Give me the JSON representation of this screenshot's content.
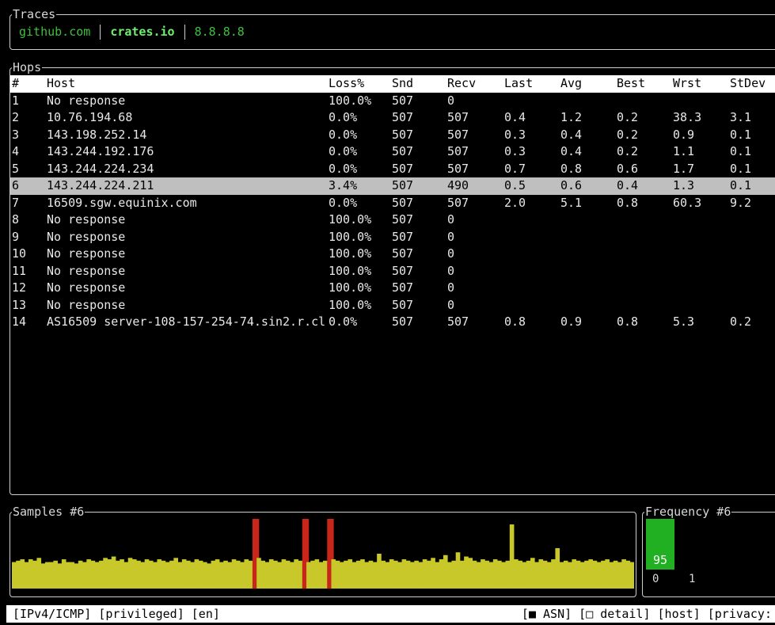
{
  "traces": {
    "title": "Traces",
    "tabs": [
      {
        "label": "github.com",
        "active": false
      },
      {
        "label": "crates.io",
        "active": true
      },
      {
        "label": "8.8.8.8",
        "active": false
      }
    ]
  },
  "hops": {
    "title": "Hops",
    "columns": [
      "#",
      "Host",
      "Loss%",
      "Snd",
      "Recv",
      "Last",
      "Avg",
      "Best",
      "Wrst",
      "StDev"
    ],
    "selected_index": 5,
    "rows": [
      [
        "1",
        "No response",
        "100.0%",
        "507",
        "0",
        "",
        "",
        "",
        "",
        ""
      ],
      [
        "2",
        "10.76.194.68",
        "0.0%",
        "507",
        "507",
        "0.4",
        "1.2",
        "0.2",
        "38.3",
        "3.1"
      ],
      [
        "3",
        "143.198.252.14",
        "0.0%",
        "507",
        "507",
        "0.3",
        "0.4",
        "0.2",
        "0.9",
        "0.1"
      ],
      [
        "4",
        "143.244.192.176",
        "0.0%",
        "507",
        "507",
        "0.3",
        "0.4",
        "0.2",
        "1.1",
        "0.1"
      ],
      [
        "5",
        "143.244.224.234",
        "0.0%",
        "507",
        "507",
        "0.7",
        "0.8",
        "0.6",
        "1.7",
        "0.1"
      ],
      [
        "6",
        "143.244.224.211",
        "3.4%",
        "507",
        "490",
        "0.5",
        "0.6",
        "0.4",
        "1.3",
        "0.1"
      ],
      [
        "7",
        "16509.sgw.equinix.com",
        "0.0%",
        "507",
        "507",
        "2.0",
        "5.1",
        "0.8",
        "60.3",
        "9.2"
      ],
      [
        "8",
        "No response",
        "100.0%",
        "507",
        "0",
        "",
        "",
        "",
        "",
        ""
      ],
      [
        "9",
        "No response",
        "100.0%",
        "507",
        "0",
        "",
        "",
        "",
        "",
        ""
      ],
      [
        "10",
        "No response",
        "100.0%",
        "507",
        "0",
        "",
        "",
        "",
        "",
        ""
      ],
      [
        "11",
        "No response",
        "100.0%",
        "507",
        "0",
        "",
        "",
        "",
        "",
        ""
      ],
      [
        "12",
        "No response",
        "100.0%",
        "507",
        "0",
        "",
        "",
        "",
        "",
        ""
      ],
      [
        "13",
        "No response",
        "100.0%",
        "507",
        "0",
        "",
        "",
        "",
        "",
        ""
      ],
      [
        "14",
        "AS16509 server-108-157-254-74.sin2.r.cl",
        "0.0%",
        "507",
        "507",
        "0.8",
        "0.9",
        "0.8",
        "5.3",
        "0.2"
      ]
    ]
  },
  "samples": {
    "title": "Samples #6",
    "bar_color": "#c8c82a",
    "loss_color": "#c8261a",
    "values": [
      0.38,
      0.4,
      0.42,
      0.38,
      0.42,
      0.4,
      0.44,
      0.36,
      0.38,
      0.38,
      0.4,
      0.36,
      0.42,
      0.38,
      0.38,
      0.36,
      0.4,
      0.38,
      0.42,
      0.4,
      0.38,
      0.4,
      0.44,
      0.42,
      0.46,
      0.4,
      0.42,
      0.38,
      0.44,
      0.42,
      0.4,
      0.38,
      0.42,
      0.4,
      0.38,
      0.42,
      0.4,
      0.38,
      0.4,
      0.44,
      0.38,
      0.42,
      0.4,
      0.38,
      0.42,
      0.4,
      0.38,
      0.36,
      0.4,
      0.42,
      0.38,
      0.4,
      0.38,
      0.42,
      0.4,
      0.38,
      0.42,
      0.4,
      0.38,
      0.44,
      0.4,
      0.38,
      0.42,
      0.4,
      0.38,
      0.42,
      0.4,
      0.38,
      0.42,
      0.4,
      0.44,
      0.38,
      0.4,
      0.42,
      0.38,
      0.4,
      0.38,
      0.42,
      0.4,
      0.38,
      0.4,
      0.42,
      0.38,
      0.4,
      0.42,
      0.38,
      0.4,
      0.38,
      0.42,
      0.4,
      0.38,
      0.42,
      0.4,
      0.38,
      0.42,
      0.4,
      0.38,
      0.4,
      0.38,
      0.42,
      0.4,
      0.44,
      0.38,
      0.42,
      0.4,
      0.38,
      0.4,
      0.42,
      0.4,
      0.46,
      0.44,
      0.4,
      0.38,
      0.42,
      0.4,
      0.38,
      0.42,
      0.4,
      0.38,
      0.4,
      0.38,
      0.42,
      0.4,
      0.38,
      0.4,
      0.44,
      0.38,
      0.42,
      0.4,
      0.38,
      0.42,
      0.4,
      0.38,
      0.4,
      0.38,
      0.42,
      0.4,
      0.38,
      0.4,
      0.42,
      0.4,
      0.38,
      0.4,
      0.42,
      0.38,
      0.4,
      0.38,
      0.42,
      0.4,
      0.38
    ],
    "loss_indices": [
      58,
      70,
      76
    ],
    "spike_indices": [
      120
    ],
    "spike_value": 0.92,
    "extra_peaks": {
      "131": 0.58,
      "104": 0.48,
      "107": 0.52,
      "88": 0.5
    }
  },
  "frequency": {
    "title": "Frequency #6",
    "bar_color": "#21b021",
    "bar_value": "95",
    "axis_labels": [
      "0",
      "1"
    ]
  },
  "status": {
    "left": "[IPv4/ICMP] [privileged] [en]",
    "right": "[■ ASN] [□ detail] [host] [privacy:"
  }
}
